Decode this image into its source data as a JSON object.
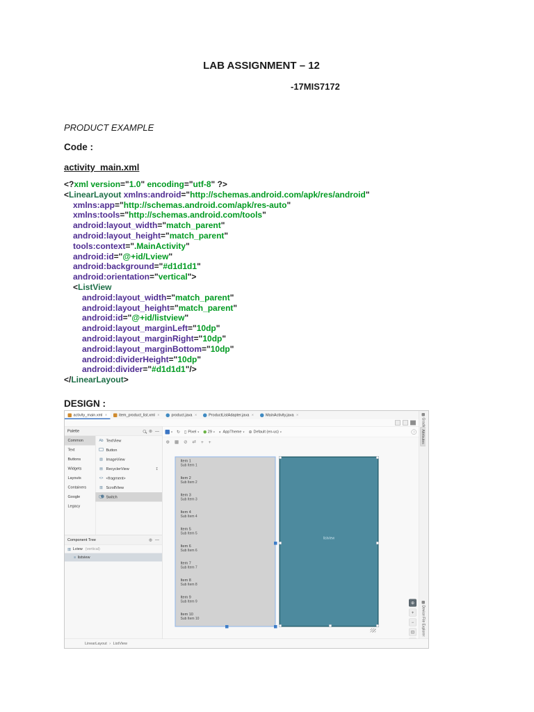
{
  "doc": {
    "title": "LAB ASSIGNMENT – 12",
    "student_id": "-17MIS7172",
    "section": "PRODUCT EXAMPLE",
    "code_label": "Code :",
    "filename": "activity_main.xml",
    "design_label": "DESIGN :"
  },
  "colors": {
    "xml_tag": "#1d6e47",
    "xml_attr": "#4f2d91",
    "xml_value": "#009a21",
    "blueprint_teal": "#4d8a9e",
    "preview_gray": "#d2d2d2",
    "selection_blue": "#3d7dc8",
    "tab_accent": "#3c76c4",
    "android_green": "#6ab344"
  },
  "code": {
    "lines": [
      {
        "in": 0,
        "tk": [
          [
            "p",
            "<?"
          ],
          [
            "v",
            "xml version"
          ],
          [
            "p",
            "=\""
          ],
          [
            "v",
            "1.0"
          ],
          [
            "p",
            "\" "
          ],
          [
            "v",
            "encoding"
          ],
          [
            "p",
            "=\""
          ],
          [
            "v",
            "utf-8"
          ],
          [
            "p",
            "\" ?>"
          ]
        ]
      },
      {
        "in": 0,
        "tk": [
          [
            "p",
            "<"
          ],
          [
            "g",
            "LinearLayout"
          ],
          [
            "p",
            " "
          ],
          [
            "a",
            "xmlns:android"
          ],
          [
            "p",
            "=\""
          ],
          [
            "v",
            "http://schemas.android.com/apk/res/android"
          ],
          [
            "p",
            "\""
          ]
        ]
      },
      {
        "in": 1,
        "tk": [
          [
            "a",
            "xmlns:app"
          ],
          [
            "p",
            "=\""
          ],
          [
            "v",
            "http://schemas.android.com/apk/res-auto"
          ],
          [
            "p",
            "\""
          ]
        ]
      },
      {
        "in": 1,
        "tk": [
          [
            "a",
            "xmlns:tools"
          ],
          [
            "p",
            "=\""
          ],
          [
            "v",
            "http://schemas.android.com/tools"
          ],
          [
            "p",
            "\""
          ]
        ]
      },
      {
        "in": 1,
        "tk": [
          [
            "a",
            "android:layout_width"
          ],
          [
            "p",
            "=\""
          ],
          [
            "v",
            "match_parent"
          ],
          [
            "p",
            "\""
          ]
        ]
      },
      {
        "in": 1,
        "tk": [
          [
            "a",
            "android:layout_height"
          ],
          [
            "p",
            "=\""
          ],
          [
            "v",
            "match_parent"
          ],
          [
            "p",
            "\""
          ]
        ]
      },
      {
        "in": 1,
        "tk": [
          [
            "a",
            "tools:context"
          ],
          [
            "p",
            "=\""
          ],
          [
            "v",
            ".MainActivity"
          ],
          [
            "p",
            "\""
          ]
        ]
      },
      {
        "in": 1,
        "tk": [
          [
            "a",
            "android:id"
          ],
          [
            "p",
            "=\""
          ],
          [
            "v",
            "@+id/Lview"
          ],
          [
            "p",
            "\""
          ]
        ]
      },
      {
        "in": 1,
        "tk": [
          [
            "a",
            "android:background"
          ],
          [
            "p",
            "=\""
          ],
          [
            "v",
            "#d1d1d1"
          ],
          [
            "p",
            "\""
          ]
        ]
      },
      {
        "in": 1,
        "tk": [
          [
            "a",
            "android:orientation"
          ],
          [
            "p",
            "=\""
          ],
          [
            "v",
            "vertical"
          ],
          [
            "p",
            "\">"
          ]
        ]
      },
      {
        "in": 1,
        "tk": [
          [
            "p",
            "<"
          ],
          [
            "g",
            "ListView"
          ]
        ]
      },
      {
        "in": 2,
        "tk": [
          [
            "a",
            "android:layout_width"
          ],
          [
            "p",
            "=\""
          ],
          [
            "v",
            "match_parent"
          ],
          [
            "p",
            "\""
          ]
        ]
      },
      {
        "in": 2,
        "tk": [
          [
            "a",
            "android:layout_height"
          ],
          [
            "p",
            "=\""
          ],
          [
            "v",
            "match_parent"
          ],
          [
            "p",
            "\""
          ]
        ]
      },
      {
        "in": 2,
        "tk": [
          [
            "a",
            "android:id"
          ],
          [
            "p",
            "=\""
          ],
          [
            "v",
            "@+id/listview"
          ],
          [
            "p",
            "\""
          ]
        ]
      },
      {
        "in": 2,
        "tk": [
          [
            "a",
            "android:layout_marginLeft"
          ],
          [
            "p",
            "=\""
          ],
          [
            "v",
            "10dp"
          ],
          [
            "p",
            "\""
          ]
        ]
      },
      {
        "in": 2,
        "tk": [
          [
            "a",
            "android:layout_marginRight"
          ],
          [
            "p",
            "=\""
          ],
          [
            "v",
            "10dp"
          ],
          [
            "p",
            "\""
          ]
        ]
      },
      {
        "in": 2,
        "tk": [
          [
            "a",
            "android:layout_marginBottom"
          ],
          [
            "p",
            "=\""
          ],
          [
            "v",
            "10dp"
          ],
          [
            "p",
            "\""
          ]
        ]
      },
      {
        "in": 2,
        "tk": [
          [
            "a",
            "android:dividerHeight"
          ],
          [
            "p",
            "=\""
          ],
          [
            "v",
            "10dp"
          ],
          [
            "p",
            "\""
          ]
        ]
      },
      {
        "in": 2,
        "tk": [
          [
            "a",
            "android:divider"
          ],
          [
            "p",
            "=\""
          ],
          [
            "v",
            "#d1d1d1"
          ],
          [
            "p",
            "\"/>"
          ]
        ]
      },
      {
        "in": 0,
        "tk": [
          [
            "p",
            "</"
          ],
          [
            "g",
            "LinearLayout"
          ],
          [
            "p",
            ">"
          ]
        ]
      }
    ]
  },
  "studio": {
    "tabs": [
      {
        "label": "activity_main.xml",
        "kind": "xml",
        "selected": true
      },
      {
        "label": "item_product_list.xml",
        "kind": "xml",
        "selected": false
      },
      {
        "label": "product.java",
        "kind": "java",
        "selected": false
      },
      {
        "label": "ProductListAdapter.java",
        "kind": "java",
        "selected": false
      },
      {
        "label": "MainActivity.java",
        "kind": "java",
        "selected": false
      }
    ],
    "view_toggles": [
      {
        "name": "code-view-icon",
        "selected": false
      },
      {
        "name": "split-view-icon",
        "selected": false
      },
      {
        "name": "design-view-icon",
        "selected": true
      }
    ],
    "palette": {
      "title": "Palette",
      "categories": [
        "Common",
        "Text",
        "Buttons",
        "Widgets",
        "Layouts",
        "Containers",
        "Google",
        "Legacy"
      ],
      "selected_category": "Common",
      "items": [
        {
          "label": "TextView",
          "icon": "textview-icon",
          "glyph": "Ab",
          "kind": "text"
        },
        {
          "label": "Button",
          "icon": "button-icon",
          "glyph": "",
          "kind": "button"
        },
        {
          "label": "ImageView",
          "icon": "imageview-icon",
          "glyph": "▨",
          "kind": "text"
        },
        {
          "label": "RecyclerView",
          "icon": "recyclerview-icon",
          "glyph": "▤",
          "kind": "text",
          "download": true
        },
        {
          "label": "<fragment>",
          "icon": "fragment-icon",
          "glyph": "<>",
          "kind": "text"
        },
        {
          "label": "ScrollView",
          "icon": "scrollview-icon",
          "glyph": "▥",
          "kind": "text"
        },
        {
          "label": "Switch",
          "icon": "switch-icon",
          "glyph": "",
          "kind": "switch",
          "selected": true
        }
      ]
    },
    "component_tree": {
      "title": "Component Tree",
      "nodes": [
        {
          "label": "Lview",
          "hint": "(vertical)",
          "depth": 0,
          "selected": false,
          "icon": "linearlayout-icon",
          "glyph": "▥"
        },
        {
          "label": "listview",
          "hint": "",
          "depth": 1,
          "selected": true,
          "icon": "listview-icon",
          "glyph": "≡"
        }
      ]
    },
    "design_toolbar": {
      "device": "Pixel",
      "api": "29",
      "theme": "AppTheme",
      "locale": "Default (en-us)"
    },
    "canvas_toolbar_icons": [
      {
        "name": "zoom-icon",
        "g": "⊕"
      },
      {
        "name": "view-options-icon",
        "g": "▦"
      },
      {
        "name": "autoconnect-off-icon",
        "g": "⊘"
      },
      {
        "name": "default-margins-icon",
        "g": "⇄"
      },
      {
        "name": "pan-horizontal-icon",
        "g": "+"
      },
      {
        "name": "pan-vertical-icon",
        "g": "+"
      }
    ],
    "zoom_controls": [
      {
        "name": "zoom-to-fit-icon",
        "g": "⊕",
        "dark": true
      },
      {
        "name": "zoom-in-icon",
        "g": "+",
        "dark": false
      },
      {
        "name": "zoom-out-icon",
        "g": "−",
        "dark": false
      },
      {
        "name": "zoom-actual-icon",
        "g": "⊡",
        "dark": false
      },
      {
        "name": "pan-surface-icon",
        "g": "▢",
        "dark": false
      }
    ],
    "preview": {
      "items": [
        {
          "title": "Item 1",
          "sub": "Sub Item 1"
        },
        {
          "title": "Item 2",
          "sub": "Sub Item 2"
        },
        {
          "title": "Item 3",
          "sub": "Sub Item 3"
        },
        {
          "title": "Item 4",
          "sub": "Sub Item 4"
        },
        {
          "title": "Item 5",
          "sub": "Sub Item 5"
        },
        {
          "title": "Item 6",
          "sub": "Sub Item 6"
        },
        {
          "title": "Item 7",
          "sub": "Sub Item 7"
        },
        {
          "title": "Item 8",
          "sub": "Sub Item 8"
        },
        {
          "title": "Item 9",
          "sub": "Sub Item 9"
        },
        {
          "title": "Item 10",
          "sub": "Sub Item 10"
        }
      ],
      "blueprint_label": "listview"
    },
    "breadcrumb": {
      "root": "LinearLayout",
      "sep": "›",
      "leaf": "ListView"
    },
    "side": {
      "gradle": "Gradle",
      "attributes": "Attributes",
      "device_file_explorer": "Device File Explorer"
    }
  }
}
